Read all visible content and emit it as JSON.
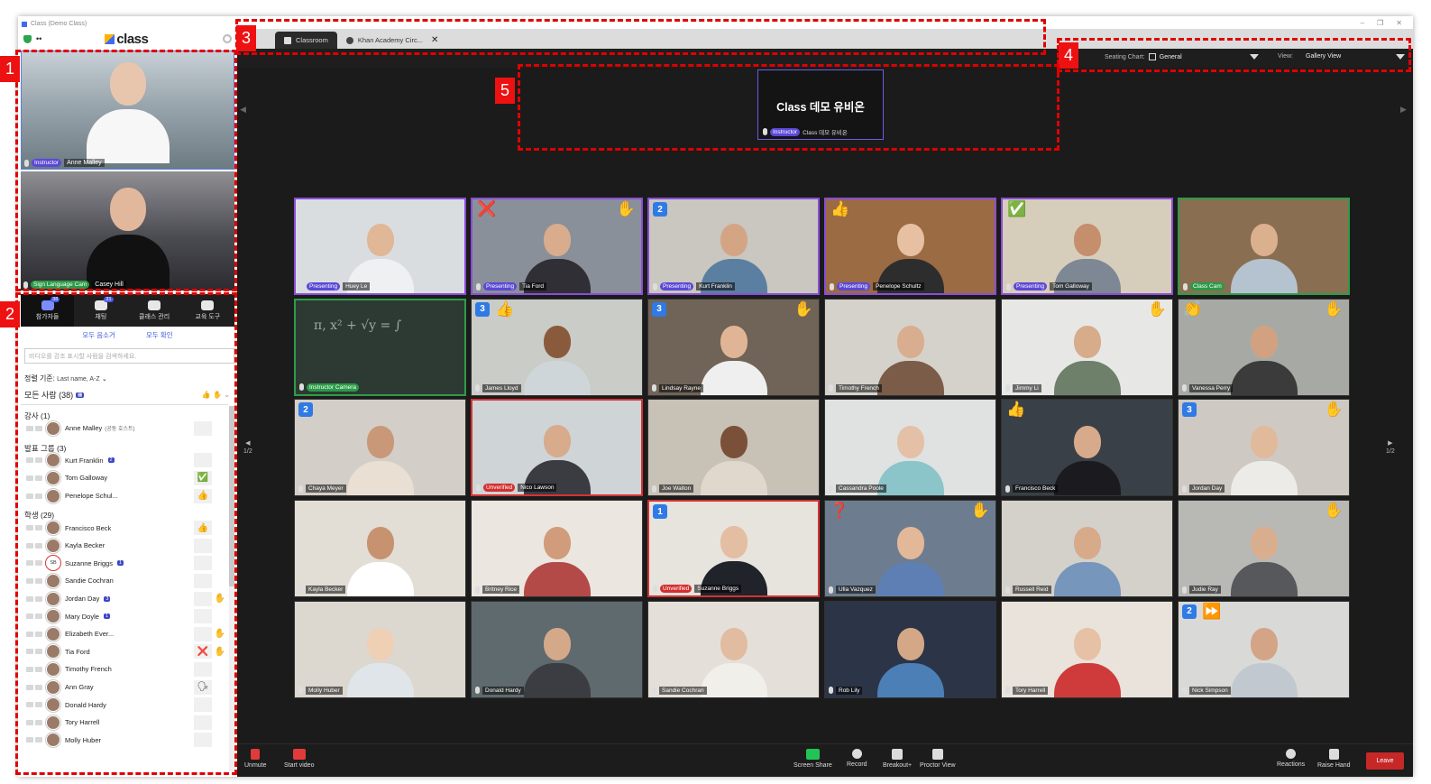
{
  "window": {
    "title": "Class (Demo Class)",
    "controls": [
      "–",
      "❐",
      "✕"
    ]
  },
  "brand": {
    "name": "class"
  },
  "left_videos": [
    {
      "role": "Instructor",
      "name": "Anne Malley"
    },
    {
      "role": "Sign Language Cam",
      "name": "Casey Hill"
    }
  ],
  "panel_tabs": [
    {
      "label": "참가자들",
      "badge": "38"
    },
    {
      "label": "채팅",
      "badge": "31"
    },
    {
      "label": "클래스 관리",
      "badge": ""
    },
    {
      "label": "교육 도구",
      "badge": ""
    }
  ],
  "panel_actions": {
    "unmute_all": "모두 음소거",
    "confirm_all": "모두 확인"
  },
  "search": {
    "placeholder": "비디오를 강조 표시할 사람을 검색하세요."
  },
  "sort": {
    "label": "정렬 기준:",
    "value": "Last name, A-Z"
  },
  "everyone": {
    "label": "모든 사람 (38)"
  },
  "groups": [
    {
      "title": "강사 (1)",
      "rows": [
        {
          "name": "Anne Malley",
          "note": "(공동 호스트)",
          "badge": "",
          "status": "",
          "extra": ""
        }
      ]
    },
    {
      "title": "발표 그룹 (3)",
      "rows": [
        {
          "name": "Kurt Franklin",
          "note": "",
          "badge": "2",
          "status": "",
          "extra": ""
        },
        {
          "name": "Tom Galloway",
          "note": "",
          "badge": "",
          "status": "✅",
          "extra": ""
        },
        {
          "name": "Penelope Schul...",
          "note": "",
          "badge": "",
          "status": "👍",
          "extra": ""
        }
      ]
    },
    {
      "title": "학생 (29)",
      "rows": [
        {
          "name": "Francisco Beck",
          "note": "",
          "badge": "",
          "status": "👍",
          "extra": ""
        },
        {
          "name": "Kayla Becker",
          "note": "",
          "badge": "",
          "status": "",
          "extra": ""
        },
        {
          "name": "Suzanne Briggs",
          "note": "",
          "badge": "1",
          "status": "",
          "extra": "",
          "initials": "SB"
        },
        {
          "name": "Sandie Cochran",
          "note": "",
          "badge": "",
          "status": "",
          "extra": ""
        },
        {
          "name": "Jordan Day",
          "note": "",
          "badge": "3",
          "status": "",
          "extra": "✋"
        },
        {
          "name": "Mary Doyle",
          "note": "",
          "badge": "1",
          "status": "",
          "extra": ""
        },
        {
          "name": "Elizabeth Ever...",
          "note": "",
          "badge": "",
          "status": "",
          "extra": "✋"
        },
        {
          "name": "Tia Ford",
          "note": "",
          "badge": "",
          "status": "❌",
          "extra": "✋"
        },
        {
          "name": "Timothy French",
          "note": "",
          "badge": "",
          "status": "",
          "extra": ""
        },
        {
          "name": "Ann Gray",
          "note": "",
          "badge": "",
          "status": "🗣",
          "extra": ""
        },
        {
          "name": "Donald Hardy",
          "note": "",
          "badge": "",
          "status": "",
          "extra": ""
        },
        {
          "name": "Tory Harrell",
          "note": "",
          "badge": "",
          "status": "",
          "extra": ""
        },
        {
          "name": "Molly Huber",
          "note": "",
          "badge": "",
          "status": "",
          "extra": ""
        }
      ]
    }
  ],
  "browser_tabs": [
    {
      "label": "Classroom"
    },
    {
      "label": "Khan Academy Circ..."
    }
  ],
  "seating": {
    "label": "Seating Chart:",
    "value": "General"
  },
  "view": {
    "label": "View:",
    "value": "Gallery View"
  },
  "stage": {
    "title": "Class 데모 유비온",
    "role": "Instructor",
    "name": "Class 데모 유비온"
  },
  "pager": {
    "left": "1/2",
    "right": "1/2"
  },
  "tiles": [
    {
      "name": "Huey Le",
      "tag": "Presenting",
      "tagtype": "purple",
      "border": "purple",
      "count": "",
      "left_emoji": "",
      "left2": "",
      "right_emoji": "",
      "bg": "#d9dde0",
      "skin": "#e0b797",
      "shirt": "#eef0f2"
    },
    {
      "name": "Tia Ford",
      "tag": "Presenting",
      "tagtype": "purple",
      "border": "purple",
      "count": "",
      "left_emoji": "❌",
      "left2": "",
      "right_emoji": "✋",
      "bg": "#8a9099",
      "skin": "#d8ac8c",
      "shirt": "#2f2f35"
    },
    {
      "name": "Kurt Franklin",
      "tag": "Presenting",
      "tagtype": "purple",
      "border": "purple",
      "count": "2",
      "left_emoji": "",
      "left2": "",
      "right_emoji": "",
      "bg": "#c9c7bf",
      "skin": "#d4a585",
      "shirt": "#5b7fa0"
    },
    {
      "name": "Penelope Schultz",
      "tag": "Presenting",
      "tagtype": "purple",
      "border": "purple",
      "count": "",
      "left_emoji": "👍",
      "left2": "",
      "right_emoji": "",
      "bg": "#9b6b43",
      "skin": "#e7c0a2",
      "shirt": "#2d2d2d"
    },
    {
      "name": "Tom Galloway",
      "tag": "Presenting",
      "tagtype": "purple",
      "border": "purple",
      "count": "",
      "left_emoji": "✅",
      "left2": "",
      "right_emoji": "",
      "bg": "#d7cdbb",
      "skin": "#c58e6d",
      "shirt": "#7d8894"
    },
    {
      "name": "Class Cam",
      "tag": "Class Cam",
      "tagtype": "green",
      "border": "green",
      "count": "",
      "left_emoji": "",
      "left2": "",
      "right_emoji": "",
      "bg": "#8a6e52",
      "skin": "#dab08e",
      "shirt": "#b5c2cf"
    },
    {
      "name": "",
      "tag": "Instructor Camera",
      "tagtype": "green",
      "border": "green",
      "count": "",
      "left_emoji": "",
      "left2": "",
      "right_emoji": "",
      "bg": "#2c3a33",
      "skin": "",
      "shirt": ""
    },
    {
      "name": "James Lloyd",
      "tag": "",
      "tagtype": "",
      "border": "",
      "count": "3",
      "left_emoji": "",
      "left2": "👍",
      "right_emoji": "",
      "bg": "#c9ccc7",
      "skin": "#8a5a3d",
      "shirt": "#cfd6da"
    },
    {
      "name": "Lindsay Rayne",
      "tag": "",
      "tagtype": "",
      "border": "",
      "count": "3",
      "left_emoji": "",
      "left2": "",
      "right_emoji": "✋",
      "bg": "#6f6457",
      "skin": "#e0b595",
      "shirt": "#efefef"
    },
    {
      "name": "Timothy French",
      "tag": "",
      "tagtype": "",
      "border": "",
      "count": "",
      "left_emoji": "",
      "left2": "",
      "right_emoji": "",
      "bg": "#d5d2cc",
      "skin": "#d9ad8f",
      "shirt": "#7a5c48"
    },
    {
      "name": "Jimmy Li",
      "tag": "",
      "tagtype": "",
      "border": "",
      "count": "",
      "left_emoji": "",
      "left2": "",
      "right_emoji": "✋",
      "bg": "#e7e8e6",
      "skin": "#d7ac8a",
      "shirt": "#6e7f6a"
    },
    {
      "name": "Vanessa Perry",
      "tag": "",
      "tagtype": "",
      "border": "",
      "count": "",
      "left_emoji": "👏",
      "left2": "",
      "right_emoji": "✋",
      "bg": "#a7aaa4",
      "skin": "#d2a182",
      "shirt": "#3b3b3b"
    },
    {
      "name": "Chaya Meyer",
      "tag": "",
      "tagtype": "",
      "border": "",
      "count": "2",
      "left_emoji": "",
      "left2": "",
      "right_emoji": "",
      "bg": "#d3cfc8",
      "skin": "#c99878",
      "shirt": "#e9dfd3"
    },
    {
      "name": "Nico Lawson",
      "tag": "Unverified",
      "tagtype": "red",
      "border": "red",
      "count": "",
      "left_emoji": "",
      "left2": "",
      "right_emoji": "",
      "bg": "#cfd4d6",
      "skin": "#d7ab8c",
      "shirt": "#3b3b42"
    },
    {
      "name": "Joe Walton",
      "tag": "",
      "tagtype": "",
      "border": "",
      "count": "",
      "left_emoji": "",
      "left2": "",
      "right_emoji": "",
      "bg": "#c7c1b6",
      "skin": "#7b5039",
      "shirt": "#e0d8cc"
    },
    {
      "name": "Cassandra Poole",
      "tag": "",
      "tagtype": "",
      "border": "",
      "count": "",
      "left_emoji": "",
      "left2": "",
      "right_emoji": "",
      "bg": "#dfe2e1",
      "skin": "#e4c0a6",
      "shirt": "#8bc4c9"
    },
    {
      "name": "Francisco Beck",
      "tag": "",
      "tagtype": "",
      "border": "",
      "count": "",
      "left_emoji": "👍",
      "left2": "",
      "right_emoji": "",
      "bg": "#3a4047",
      "skin": "#d6aa8b",
      "shirt": "#1b1b1f"
    },
    {
      "name": "Jordan Day",
      "tag": "",
      "tagtype": "",
      "border": "",
      "count": "3",
      "left_emoji": "",
      "left2": "",
      "right_emoji": "✋",
      "bg": "#cfc9c3",
      "skin": "#e1b99b",
      "shirt": "#ecebe8"
    },
    {
      "name": "Kayla Becker",
      "tag": "",
      "tagtype": "",
      "border": "",
      "count": "",
      "left_emoji": "",
      "left2": "",
      "right_emoji": "",
      "bg": "#e2ded5",
      "skin": "#c79270",
      "shirt": "#ffffff"
    },
    {
      "name": "Britney Rice",
      "tag": "",
      "tagtype": "",
      "border": "",
      "count": "",
      "left_emoji": "",
      "left2": "",
      "right_emoji": "",
      "bg": "#ebe6e0",
      "skin": "#d09c7b",
      "shirt": "#b34a48"
    },
    {
      "name": "Suzanne Briggs",
      "tag": "Unverified",
      "tagtype": "red",
      "border": "red",
      "count": "1",
      "left_emoji": "",
      "left2": "",
      "right_emoji": "",
      "bg": "#e7e3dd",
      "skin": "#e3bea2",
      "shirt": "#20232a"
    },
    {
      "name": "Ulla Vazquez",
      "tag": "",
      "tagtype": "",
      "border": "",
      "count": "",
      "left_emoji": "❓",
      "left2": "",
      "right_emoji": "✋",
      "bg": "#6d7d8f",
      "skin": "#e2b898",
      "shirt": "#5d7fb4"
    },
    {
      "name": "Russell Reid",
      "tag": "",
      "tagtype": "",
      "border": "",
      "count": "",
      "left_emoji": "",
      "left2": "",
      "right_emoji": "",
      "bg": "#d4d1cb",
      "skin": "#d7ab8a",
      "shirt": "#7796bc"
    },
    {
      "name": "Judie Ray",
      "tag": "",
      "tagtype": "",
      "border": "",
      "count": "",
      "left_emoji": "",
      "left2": "",
      "right_emoji": "✋",
      "bg": "#b8b8b4",
      "skin": "#d9ae8f",
      "shirt": "#57585c"
    },
    {
      "name": "Molly Huber",
      "tag": "",
      "tagtype": "",
      "border": "",
      "count": "",
      "left_emoji": "",
      "left2": "",
      "right_emoji": "",
      "bg": "#dcd7cf",
      "skin": "#efd0b5",
      "shirt": "#dfe5e8"
    },
    {
      "name": "Donald Hardy",
      "tag": "",
      "tagtype": "",
      "border": "",
      "count": "",
      "left_emoji": "",
      "left2": "",
      "right_emoji": "",
      "bg": "#5f6a6e",
      "skin": "#d4a98a",
      "shirt": "#3c3d42"
    },
    {
      "name": "Sandie Cochran",
      "tag": "",
      "tagtype": "",
      "border": "",
      "count": "",
      "left_emoji": "",
      "left2": "",
      "right_emoji": "",
      "bg": "#e4e0d9",
      "skin": "#e2bca0",
      "shirt": "#f1efe9"
    },
    {
      "name": "Rob Lily",
      "tag": "",
      "tagtype": "",
      "border": "",
      "count": "",
      "left_emoji": "",
      "left2": "",
      "right_emoji": "",
      "bg": "#2c3447",
      "skin": "#d4a787",
      "shirt": "#4b7fb6"
    },
    {
      "name": "Tory Harrell",
      "tag": "",
      "tagtype": "",
      "border": "",
      "count": "",
      "left_emoji": "",
      "left2": "",
      "right_emoji": "",
      "bg": "#e9e3dc",
      "skin": "#e7c1a5",
      "shirt": "#cf3b3b"
    },
    {
      "name": "Nick Simpson",
      "tag": "",
      "tagtype": "",
      "border": "",
      "count": "2",
      "left_emoji": "",
      "left2": "⏩",
      "right_emoji": "",
      "bg": "#d9dad7",
      "skin": "#d3a586",
      "shirt": "#c1c8cf"
    }
  ],
  "toolbar": {
    "unmute": "Unmute",
    "start_video": "Start video",
    "screen_share": "Screen Share",
    "record": "Record",
    "breakout": "Breakout+",
    "proctor": "Proctor View",
    "reactions": "Reactions",
    "raise_hand": "Raise Hand",
    "leave": "Leave"
  },
  "annotations": [
    "1",
    "2",
    "3",
    "4",
    "5"
  ]
}
